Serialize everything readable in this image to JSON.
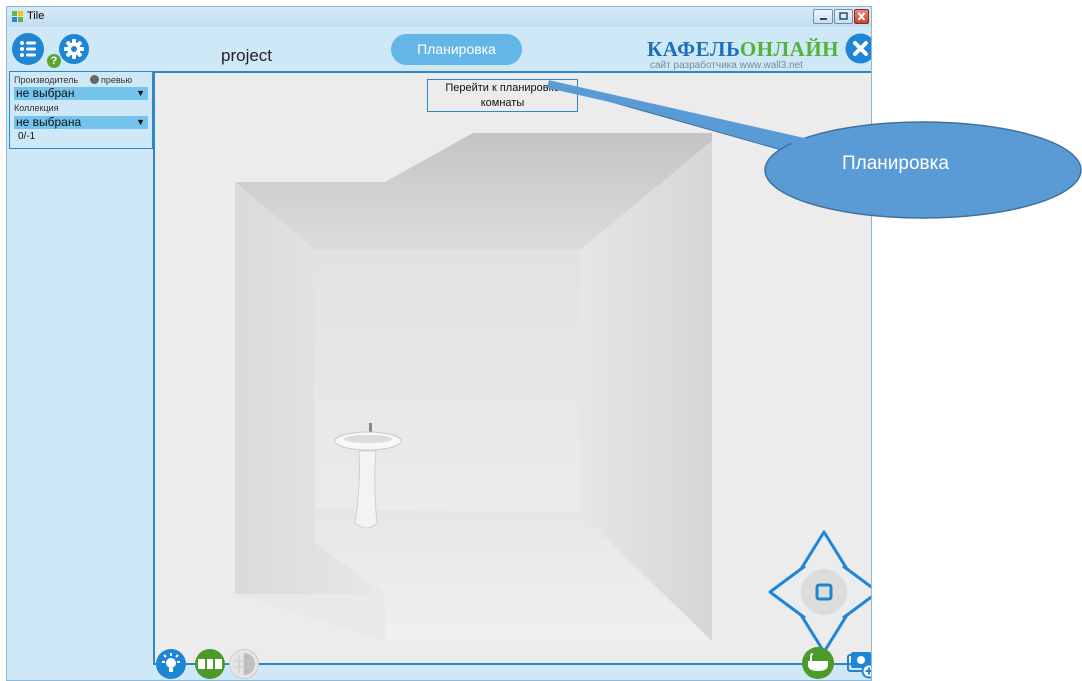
{
  "window": {
    "title": "Tile"
  },
  "toolbar": {
    "help_badge": "?",
    "project_name": "project",
    "plan_button": "Планировка",
    "brand_part1": "КАФЕЛЬ",
    "brand_part2": "ОНЛАЙН",
    "brand_subtitle": "сайт разработчика www.wall3.net"
  },
  "filters": {
    "manufacturer_label": "Производитель",
    "preview_label": "превью",
    "manufacturer_value": "не выбран",
    "collection_label": "Коллекция",
    "collection_value": "не выбрана",
    "counter": "0/-1"
  },
  "viewport": {
    "hint_line1": "Перейти к планировке",
    "hint_line2": "комнаты"
  },
  "callout": {
    "text": "Планировка"
  },
  "colors": {
    "window_bg": "#cfe8f7",
    "accent_blue": "#1f86d5",
    "accent_green": "#4c9a2a",
    "plan_button_bg": "#64b6e6",
    "callout_fill": "#5b9bd5"
  },
  "icons": [
    "app-icon",
    "list-icon",
    "gear-icon",
    "help-icon",
    "close-icon",
    "light-icon",
    "tiles-icon",
    "grid-icon",
    "bath-icon",
    "camera-add-icon",
    "nav-up-icon",
    "nav-down-icon",
    "nav-left-icon",
    "nav-right-icon",
    "nav-center-icon"
  ]
}
